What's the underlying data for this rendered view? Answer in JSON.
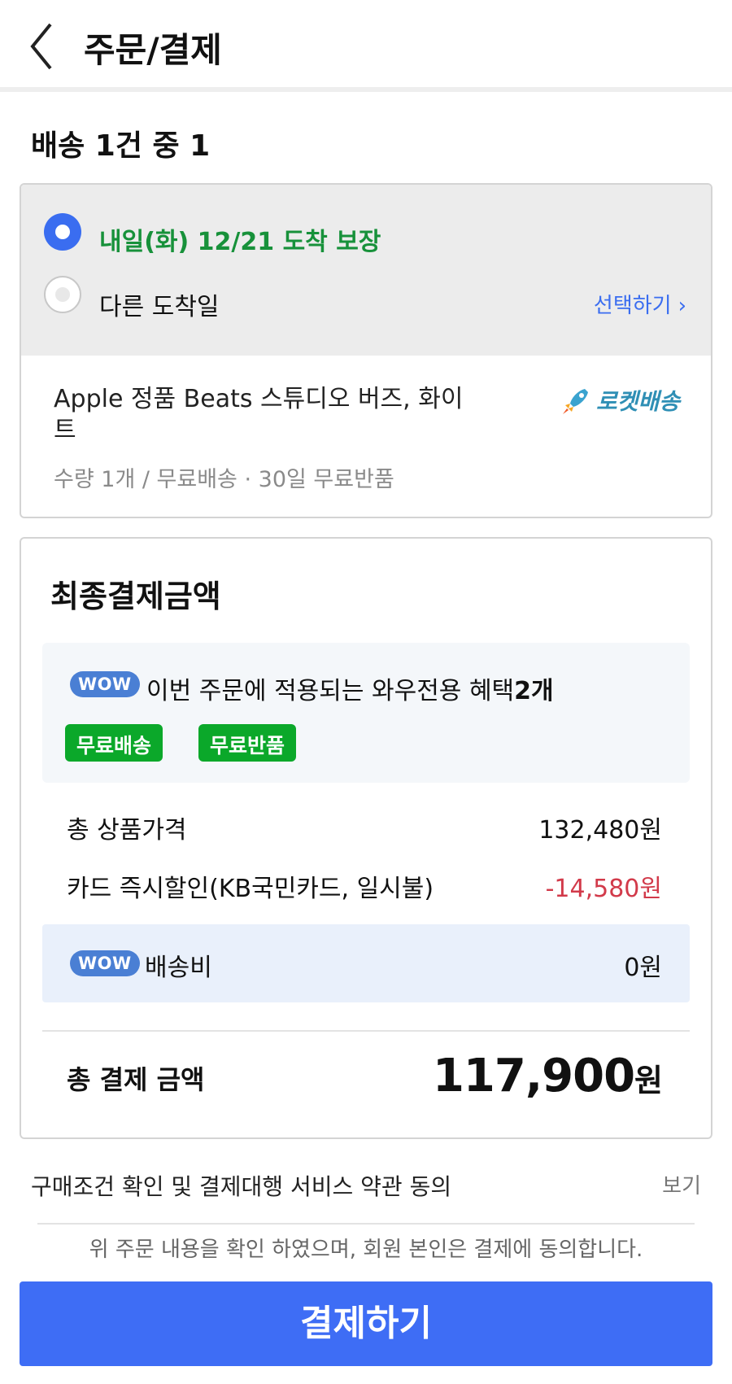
{
  "header": {
    "title": "주문/결제"
  },
  "shipment": {
    "count_label": "배송 1건 중 1"
  },
  "delivery": {
    "option1_label": "내일(화) 12/21 도착 보장",
    "option2_label": "다른 도착일",
    "select_link": "선택하기",
    "option1_color": "#17913a"
  },
  "product": {
    "name": "Apple 정품 Beats 스튜디오 버즈, 화이트",
    "meta": "수량 1개 / 무료배송 · 30일 무료반품",
    "badge": "로켓배송"
  },
  "payment": {
    "title": "최종결제금액",
    "wow_badge": "WOW",
    "wow_benefit_text": "이번 주문에 적용되는 와우전용 혜택",
    "wow_benefit_count": "2개",
    "chips": [
      "무료배송",
      "무료반품"
    ],
    "rows": [
      {
        "label": "총 상품가격",
        "value": "132,480원"
      },
      {
        "label": "카드 즉시할인(KB국민카드, 일시불)",
        "value": "-14,580원"
      }
    ],
    "shipping_label": "배송비",
    "shipping_value": "0원",
    "total_label": "총 결제 금액",
    "total_amount": "117,900",
    "total_unit": "원",
    "discount_color": "#d23a4a"
  },
  "terms": {
    "label": "구매조건 확인 및 결제대행 서비스 약관 동의",
    "view": "보기",
    "consent": "위 주문 내용을 확인 하였으며, 회원 본인은 결제에 동의합니다."
  },
  "pay_button": {
    "label": "결제하기",
    "color": "#3e6df5"
  }
}
